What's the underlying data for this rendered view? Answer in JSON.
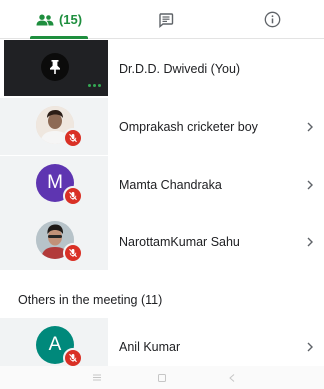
{
  "tabs": {
    "people_count": "(15)",
    "active_tab": "people",
    "accent_color": "#1e8e3e"
  },
  "participants": [
    {
      "name": "Dr.D.D. Dwivedi (You)",
      "avatar_icon": "pin-icon",
      "muted": false
    },
    {
      "name": "Omprakash cricketer boy",
      "avatar_icon": "profile-photo",
      "muted": true
    },
    {
      "name": "Mamta Chandraka",
      "avatar_letter": "M",
      "avatar_color": "#5e35b1",
      "muted": true
    },
    {
      "name": "NarottamKumar Sahu",
      "avatar_icon": "profile-photo",
      "muted": true
    }
  ],
  "others_section": {
    "title": "Others in the meeting (11)",
    "items": [
      {
        "name": "Anil Kumar",
        "avatar_letter": "A",
        "avatar_color": "#00897b",
        "muted": true
      }
    ]
  },
  "colors": {
    "muted_badge": "#d93025",
    "tile_bg": "#f1f3f4",
    "self_tile_bg": "#202124"
  }
}
